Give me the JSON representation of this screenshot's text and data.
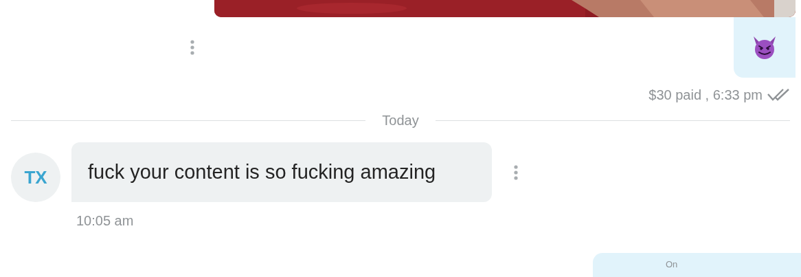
{
  "sent_emoji": {
    "status": "$30 paid , 6:33 pm",
    "read": true
  },
  "day_divider": "Today",
  "incoming": {
    "avatar": "TX",
    "text": "fuck your content is so fucking amazing",
    "time": "10:05 am"
  },
  "outgoing_preview": {
    "label": "On"
  }
}
